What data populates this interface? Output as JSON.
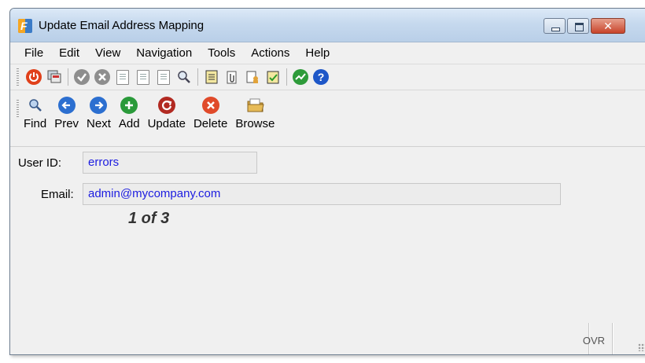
{
  "window": {
    "title": "Update Email Address Mapping",
    "close_glyph": "✕"
  },
  "menu": {
    "items": [
      "File",
      "Edit",
      "View",
      "Navigation",
      "Tools",
      "Actions",
      "Help"
    ]
  },
  "toolbar_icons": [
    "power-icon",
    "copy-screen-icon",
    "check-icon",
    "cancel-icon",
    "page-copy-icon",
    "page-paste-icon",
    "page-select-icon",
    "zoom-icon",
    "notepad-icon",
    "attach-icon",
    "user-doc-icon",
    "calendar-icon",
    "chart-icon",
    "help-icon"
  ],
  "actions": {
    "find": "Find",
    "prev": "Prev",
    "next": "Next",
    "add": "Add",
    "update": "Update",
    "delete": "Delete",
    "browse": "Browse"
  },
  "form": {
    "user_id_label": "User ID:",
    "user_id_value": "errors",
    "email_label": "Email:",
    "email_value": "admin@mycompany.com",
    "record_counter": "1 of 3"
  },
  "status": {
    "mode": "OVR"
  },
  "colors": {
    "field_text": "#1c1ce0",
    "title_gradient_top": "#dce9f7",
    "close_button": "#c8442b"
  }
}
